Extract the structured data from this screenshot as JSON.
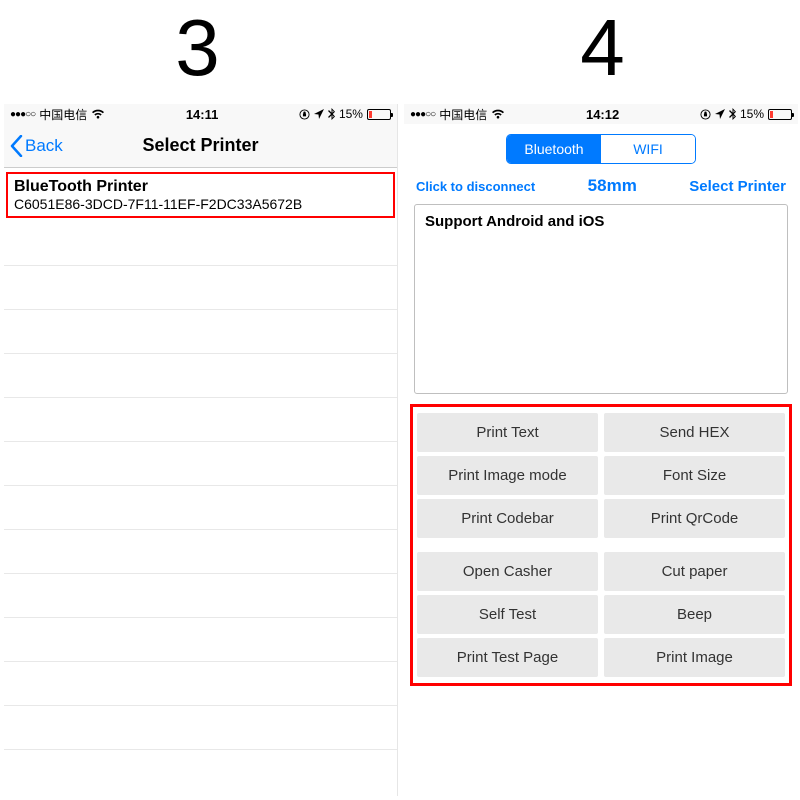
{
  "labels": {
    "left": "3",
    "right": "4"
  },
  "statusbar": {
    "carrier": "中国电信",
    "time_left": "14:11",
    "time_right": "14:12",
    "battery_pct": "15%"
  },
  "left": {
    "back_label": "Back",
    "title": "Select Printer",
    "printer_name": "BlueTooth Printer",
    "printer_id": "C6051E86-3DCD-7F11-11EF-F2DC33A5672B"
  },
  "right": {
    "seg_bluetooth": "Bluetooth",
    "seg_wifi": "WIFI",
    "disconnect": "Click to disconnect",
    "size": "58mm",
    "select_printer": "Select Printer",
    "textarea_text": "Support Android and iOS",
    "buttons": {
      "g1": [
        [
          "Print Text",
          "Send HEX"
        ],
        [
          "Print Image mode",
          "Font Size"
        ],
        [
          "Print Codebar",
          "Print QrCode"
        ]
      ],
      "g2": [
        [
          "Open Casher",
          "Cut paper"
        ],
        [
          "Self Test",
          "Beep"
        ],
        [
          "Print Test Page",
          "Print Image"
        ]
      ]
    }
  }
}
